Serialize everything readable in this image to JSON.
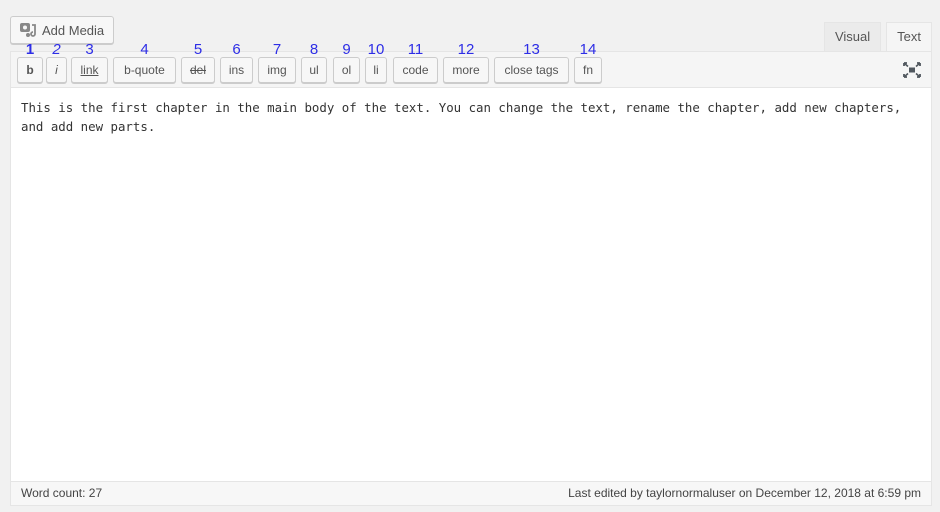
{
  "add_media": {
    "label": "Add Media",
    "icon": "media-icon"
  },
  "tabs": [
    {
      "label": "Visual",
      "active": false
    },
    {
      "label": "Text",
      "active": true
    }
  ],
  "toolbar": {
    "buttons": [
      {
        "num": "1",
        "label": "b"
      },
      {
        "num": "2",
        "label": "i"
      },
      {
        "num": "3",
        "label": "link"
      },
      {
        "num": "4",
        "label": "b-quote"
      },
      {
        "num": "5",
        "label": "del"
      },
      {
        "num": "6",
        "label": "ins"
      },
      {
        "num": "7",
        "label": "img"
      },
      {
        "num": "8",
        "label": "ul"
      },
      {
        "num": "9",
        "label": "ol"
      },
      {
        "num": "10",
        "label": "li"
      },
      {
        "num": "11",
        "label": "code"
      },
      {
        "num": "12",
        "label": "more"
      },
      {
        "num": "13",
        "label": "close tags"
      },
      {
        "num": "14",
        "label": "fn"
      }
    ],
    "fullscreen_icon": "fullscreen-icon"
  },
  "content": {
    "text": "This is the first chapter in the main body of the text. You can change the text, rename the chapter, add new chapters, and add new parts."
  },
  "status": {
    "word_count": "Word count: 27",
    "last_edited": "Last edited by taylornormaluser on December 12, 2018 at 6:59 pm"
  },
  "colors": {
    "annotation_numbers": "#2d2de6"
  }
}
